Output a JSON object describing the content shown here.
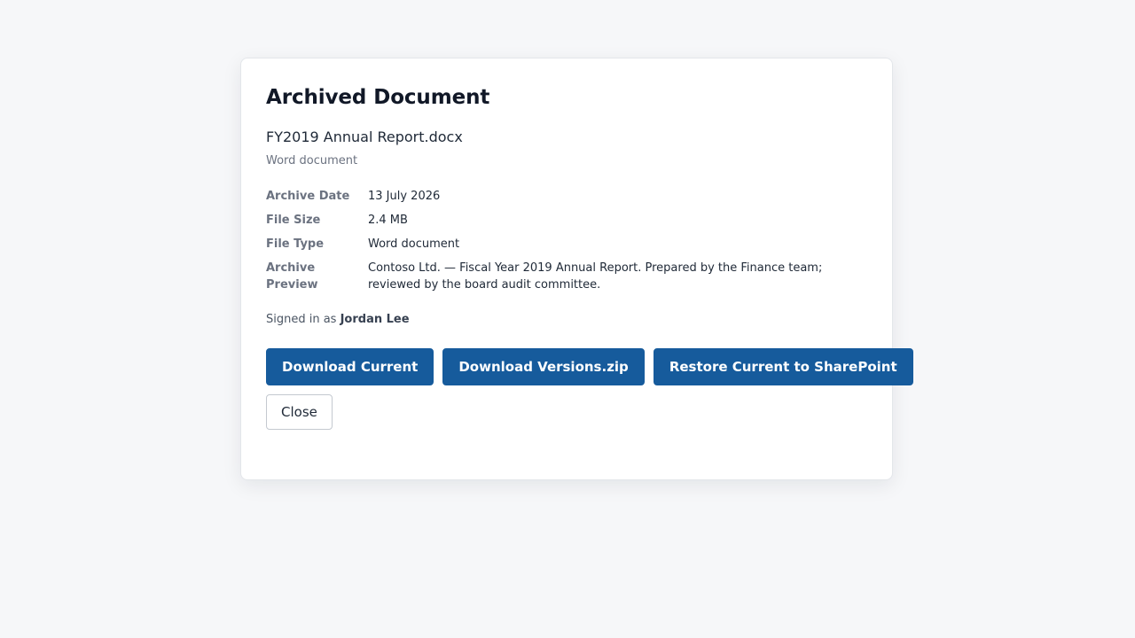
{
  "dialog": {
    "title": "Archived Document",
    "file_name": "FY2019 Annual Report.docx",
    "file_kind": "Word document",
    "details": [
      {
        "label": "Archive Date",
        "value": "13 July 2026"
      },
      {
        "label": "File Size",
        "value": "2.4 MB"
      },
      {
        "label": "File Type",
        "value": "Word document"
      },
      {
        "label": "Archive Preview",
        "value": "Contoso Ltd. — Fiscal Year 2019 Annual Report. Prepared by the Finance team; reviewed by the board audit committee."
      }
    ],
    "signed_in_prefix": "Signed in as",
    "signed_in_user": "Jordan Lee",
    "buttons": {
      "download_current": "Download Current",
      "download_versions": "Download Versions.zip",
      "restore": "Restore Current to SharePoint",
      "close": "Close"
    }
  },
  "colors": {
    "page_background": "#f6f7f9",
    "primary_button": "#165b9c"
  }
}
